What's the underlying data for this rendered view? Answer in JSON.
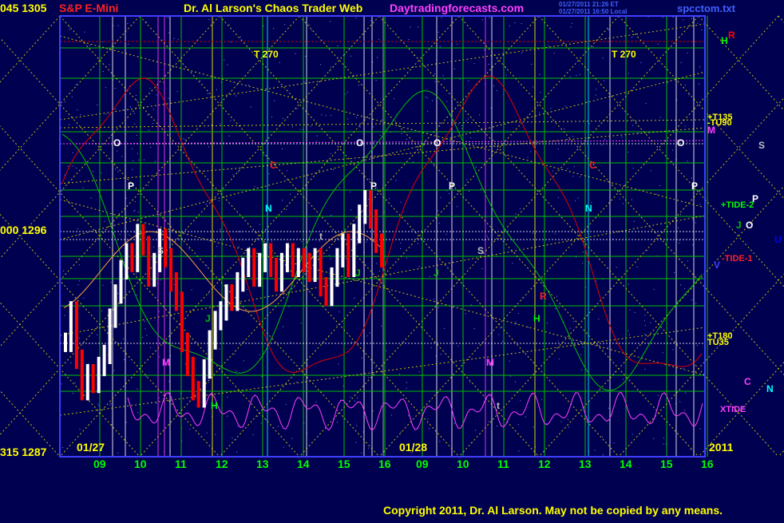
{
  "header": {
    "left_price": "045 1305",
    "instrument": "S&P E-Mini",
    "title": "Dr. Al Larson's Chaos Trader Web",
    "site": "Daytradingforecasts.com",
    "stamp_line1": "01/27/2011 21:26 ET",
    "stamp_line2": "01/27/2011 16:50 Local",
    "filename": "spcctom.txt"
  },
  "y_axis_labels": [
    "045 1305",
    "000 1296",
    "315 1287"
  ],
  "date_labels": {
    "left": "01/27",
    "middle": "01/28",
    "right": "2011"
  },
  "footer": {
    "copyright": "Copyright 2011, Dr. Al Larson. May not be copied by any means."
  },
  "colors": {
    "background": "#000050",
    "frame": "#4040ff",
    "grid_green": "#00c000",
    "dotted_yellow": "#e0e000",
    "wave_green": "#00c000",
    "wave_red": "#e00000",
    "xtide": "#ff40ff",
    "bar_white": "#ffffff",
    "bar_red": "#ff0000"
  },
  "chart_data": {
    "type": "bar",
    "title": "S&P E-Mini",
    "y_range": [
      1287,
      1305
    ],
    "y_ticks": [
      {
        "angle": "045",
        "price": 1305
      },
      {
        "angle": "000",
        "price": 1296
      },
      {
        "angle": "315",
        "price": 1287
      }
    ],
    "sessions": [
      {
        "date": "01/27",
        "hours": [
          "09",
          "10",
          "11",
          "12",
          "13",
          "14",
          "15",
          "16"
        ]
      },
      {
        "date": "01/28",
        "hours": [
          "09",
          "10",
          "11",
          "12",
          "13",
          "14",
          "15",
          "16"
        ]
      }
    ],
    "right_labels": [
      {
        "text": "H",
        "color": "#00ff00"
      },
      {
        "text": "R",
        "color": "#ff0000"
      },
      {
        "text": "+T135",
        "color": "#ffff00"
      },
      {
        "text": "-TU90",
        "color": "#ffff00"
      },
      {
        "text": "M",
        "color": "#ff40ff"
      },
      {
        "text": "S",
        "color": "#c0c0c0"
      },
      {
        "text": "+TIDE-2",
        "color": "#00ff00"
      },
      {
        "text": "P",
        "color": "#ffffff"
      },
      {
        "text": "J",
        "color": "#00c000"
      },
      {
        "text": "O",
        "color": "#ffffff"
      },
      {
        "text": "U",
        "color": "#0000ff"
      },
      {
        "text": "-TIDE-1",
        "color": "#ff2020"
      },
      {
        "text": "V",
        "color": "#4040ff"
      },
      {
        "text": "+T180",
        "color": "#ffff00"
      },
      {
        "text": "TU35",
        "color": "#ffff00"
      },
      {
        "text": "C",
        "color": "#ff40ff"
      },
      {
        "text": "N",
        "color": "#00ffff"
      },
      {
        "text": "XTIDE",
        "color": "#ff40ff"
      }
    ],
    "planet_markers": [
      {
        "text": "T 270",
        "color": "#ffff00"
      },
      {
        "text": "T 270",
        "color": "#ffff00"
      },
      {
        "text": "O",
        "color": "#ffffff"
      },
      {
        "text": "O",
        "color": "#ffffff"
      },
      {
        "text": "O",
        "color": "#ffffff"
      },
      {
        "text": "O",
        "color": "#ffffff"
      },
      {
        "text": "P",
        "color": "#ffffff"
      },
      {
        "text": "P",
        "color": "#ffffff"
      },
      {
        "text": "P",
        "color": "#ffffff"
      },
      {
        "text": "P",
        "color": "#ffffff"
      },
      {
        "text": "C",
        "color": "#ff2020"
      },
      {
        "text": "C",
        "color": "#ff2020"
      },
      {
        "text": "N",
        "color": "#00ffff"
      },
      {
        "text": "N",
        "color": "#00ffff"
      },
      {
        "text": "S",
        "color": "#c0c0c0"
      },
      {
        "text": "S",
        "color": "#c0c0c0"
      },
      {
        "text": "J",
        "color": "#00c000"
      },
      {
        "text": "J",
        "color": "#00c000"
      },
      {
        "text": "J",
        "color": "#00c000"
      },
      {
        "text": "M",
        "color": "#ff40ff"
      },
      {
        "text": "M",
        "color": "#ff40ff"
      },
      {
        "text": "R",
        "color": "#ff2020"
      },
      {
        "text": "H",
        "color": "#00ff00"
      },
      {
        "text": "H",
        "color": "#00ff00"
      },
      {
        "text": "t",
        "color": "#c0c0c0"
      },
      {
        "text": "t",
        "color": "#c0c0c0"
      }
    ],
    "price_bars": [
      1291.5,
      1292.8,
      1290.8,
      1289.5,
      1290.2,
      1289.8,
      1290.5,
      1291.0,
      1292.5,
      1293.5,
      1294.5,
      1295.2,
      1294.8,
      1296.0,
      1295.5,
      1294.2,
      1294.8,
      1295.8,
      1295.0,
      1294.0,
      1293.2,
      1291.5,
      1290.5,
      1289.5,
      1289.2,
      1290.4,
      1291.6,
      1292.4,
      1292.8,
      1293.5,
      1293.2,
      1294.0,
      1294.6,
      1295.0,
      1294.2,
      1294.8,
      1295.2,
      1294.6,
      1294.0,
      1294.8,
      1295.2,
      1294.6,
      1295.0,
      1294.8,
      1294.4,
      1295.0,
      1293.8,
      1293.4,
      1294.2,
      1295.0,
      1295.6,
      1294.6,
      1296.0,
      1296.8,
      1297.4,
      1296.6,
      1295.6,
      1295.0
    ]
  }
}
